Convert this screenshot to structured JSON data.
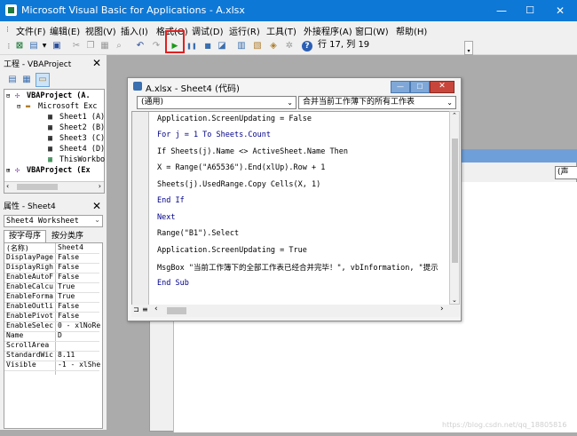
{
  "window": {
    "title": "Microsoft Visual Basic for Applications - A.xlsx",
    "minimize": "—",
    "maximize": "☐",
    "close": "✕"
  },
  "menu": [
    "文件(F)",
    "编辑(E)",
    "视图(V)",
    "插入(I)",
    "格式(O)",
    "调试(D)",
    "运行(R)",
    "工具(T)",
    "外接程序(A)",
    "窗口(W)",
    "帮助(H)"
  ],
  "toolbar": {
    "position": "行 17, 列 19"
  },
  "project": {
    "title": "工程 - VBAProject",
    "nodes": [
      "VBAProject (A.",
      "Microsoft Exc",
      "Sheet1 (A)",
      "Sheet2 (B)",
      "Sheet3 (C)",
      "Sheet4 (D)",
      "ThisWorkbo",
      "VBAProject (Ex"
    ]
  },
  "properties": {
    "title": "属性 - Sheet4",
    "object": "Sheet4 Worksheet",
    "tabs": [
      "按字母序",
      "按分类序"
    ],
    "rows": [
      [
        "(名称)",
        "Sheet4"
      ],
      [
        "DisplayPage",
        "False"
      ],
      [
        "DisplayRigh",
        "False"
      ],
      [
        "EnableAutoF",
        "False"
      ],
      [
        "EnableCalcu",
        "True"
      ],
      [
        "EnableForma",
        "True"
      ],
      [
        "EnableOutli",
        "False"
      ],
      [
        "EnablePivot",
        "False"
      ],
      [
        "EnableSelec",
        "0 - xlNoRe"
      ],
      [
        "Name",
        "D"
      ],
      [
        "ScrollArea",
        ""
      ],
      [
        "StandardWic",
        "8.11"
      ],
      [
        "Visible",
        "-1 - xlShe"
      ]
    ]
  },
  "codewindow": {
    "title": "A.xlsx - Sheet4 (代码)",
    "object_combo": "(通用)",
    "proc_combo": "合并当前工作薄下的所有工作表",
    "lines": [
      "Application.ScreenUpdating = False",
      "For j = 1 To Sheets.Count",
      "If Sheets(j).Name <> ActiveSheet.Name Then",
      "X = Range(\"A65536\").End(xlUp).Row + 1",
      "Sheets(j).UsedRange.Copy Cells(X, 1)",
      "End If",
      "Next",
      "Range(\"B1\").Select",
      "Application.ScreenUpdating = True",
      "MsgBox \"当前工作簿下的全部工作表已经合并完毕！\", vbInformation, \"提示",
      "End Sub"
    ]
  },
  "background_combo": "(声",
  "watermark": "https://blog.csdn.net/qq_18805816"
}
